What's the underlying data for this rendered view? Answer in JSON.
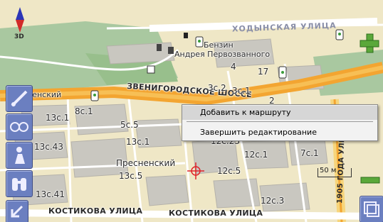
{
  "view": {
    "mode_3d_label": "3D"
  },
  "map": {
    "streets": {
      "khodynskaya": "ХОДЫНСКАЯ УЛИЦА",
      "zvenigorodskoe": "ЗВЕНИГОРОДСКОЕ ШОССЕ",
      "kostikova_left": "КОСТИКОВА УЛИЦА",
      "kostikova_right": "КОСТИКОВА УЛИЦА",
      "presnenskiy_val_left": "ненский",
      "street_1905": "1905 ГОДА УЛИЦА"
    },
    "pois": {
      "fuel": "Бензин",
      "church": "Андрея Первозванного"
    },
    "districts": {
      "presnenskiy": "Пресненский"
    },
    "buildings": [
      "13с.1",
      "8с.1",
      "5с.5",
      "13с.1",
      "13с.43",
      "12с.23",
      "12с.1",
      "7с.1",
      "12с.5",
      "13с.5",
      "13с.41",
      "12с.3",
      "3с.2",
      "3с.1",
      "17",
      "4",
      "2"
    ],
    "scale_label": "50 м"
  },
  "context_menu": {
    "items": [
      "Добавить к маршруту",
      "Завершить редактирование"
    ],
    "highlighted_index": 0
  },
  "left_toolbar": [
    "route-button",
    "glasses-button",
    "man-button",
    "binoculars-button",
    "menu-arrow-button"
  ],
  "right_toolbar": [
    "zoom-in-button",
    "zoom-out-button",
    "window-button"
  ]
}
